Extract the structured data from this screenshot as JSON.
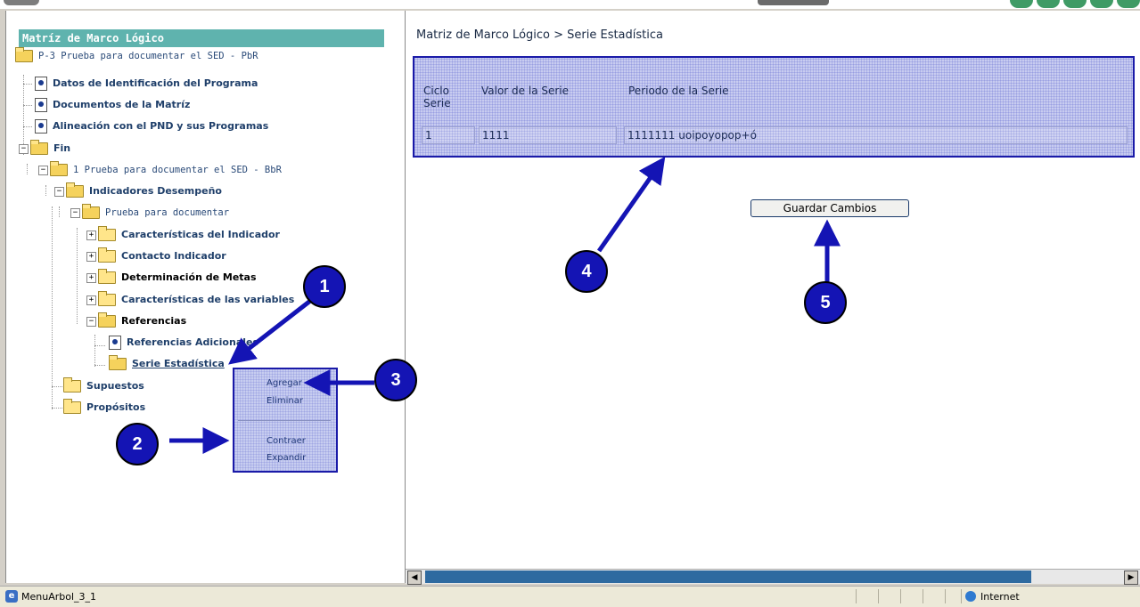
{
  "left_panel": {
    "title": "Matríz de Marco Lógico",
    "tree": {
      "root": "P-3 Prueba para documentar el SED - PbR",
      "datos": "Datos de Identificación del Programa",
      "documentos": "Documentos de la Matríz",
      "alineacion": "Alineación con el PND y sus Programas",
      "fin": "Fin",
      "fin_child": "1 Prueba para documentar el SED - BbR",
      "indicadores": "Indicadores Desempeño",
      "prueba": "Prueba para documentar",
      "caracteristicas_ind": "Características del Indicador",
      "contacto": "Contacto Indicador",
      "determinacion": "Determinación de Metas",
      "caracteristicas_var": "Características de las variables",
      "referencias": "Referencias",
      "referencias_ad": "Referencias Adicionales",
      "serie": "Serie Estadística",
      "supuestos": "Supuestos",
      "propositos": "Propósitos"
    },
    "context_menu": {
      "agregar": "Agregar",
      "eliminar": "Eliminar",
      "contraer": "Contraer",
      "expandir": "Expandir"
    }
  },
  "right_panel": {
    "breadcrumb": "Matriz de Marco Lógico > Serie Estadística",
    "grid": {
      "headers": {
        "ciclo": "Ciclo Serie",
        "valor": "Valor de la Serie",
        "periodo": "Periodo de la Serie"
      },
      "row": {
        "ciclo": "1",
        "valor": "1111",
        "periodo": "1111111 uoipoyopop+ó"
      }
    },
    "save_label": "Guardar Cambios"
  },
  "status_bar": {
    "left": "MenuArbol_3_1",
    "zone": "Internet"
  },
  "callouts": [
    "1",
    "2",
    "3",
    "4",
    "5"
  ],
  "colors": {
    "callout": "#1414b4",
    "title_bar": "#5fb3ae",
    "highlight": "#1a1aa8"
  },
  "icons": [
    "folder-icon",
    "document-icon",
    "globe-icon",
    "ie-icon"
  ]
}
